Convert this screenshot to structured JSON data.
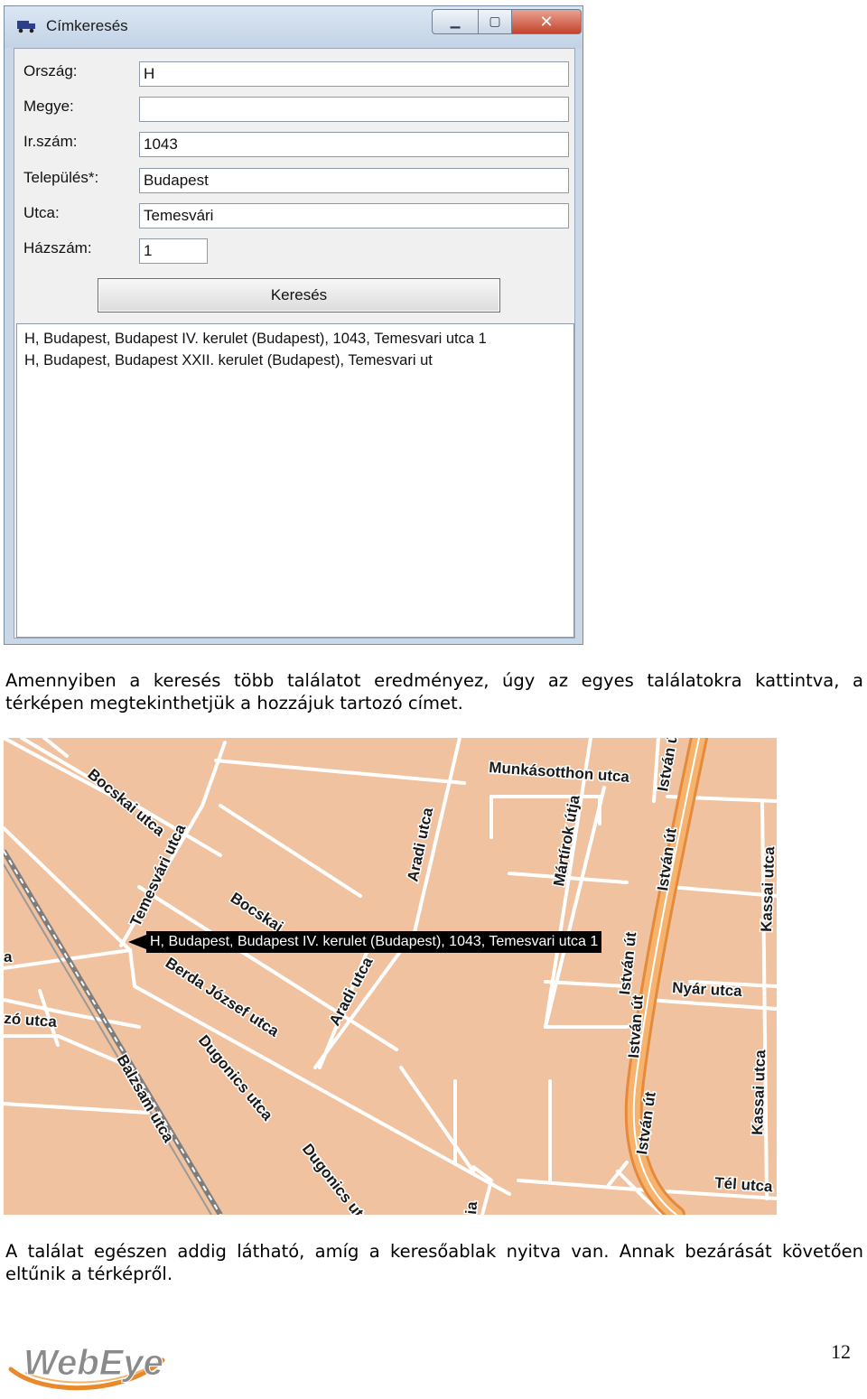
{
  "dialog": {
    "title": "Címkeresés",
    "controls": {
      "minimize": "▁",
      "maximize": "▢",
      "close": "✕"
    },
    "fields": [
      {
        "label": "Ország:",
        "value": "H"
      },
      {
        "label": "Megye:",
        "value": ""
      },
      {
        "label": "Ir.szám:",
        "value": "1043"
      },
      {
        "label": "Település*:",
        "value": "Budapest"
      },
      {
        "label": "Utca:",
        "value": "Temesvári"
      },
      {
        "label": "Házszám:",
        "value": "1"
      }
    ],
    "search_button": "Keresés",
    "results": [
      "H, Budapest, Budapest IV. kerulet (Budapest), 1043, Temesvari utca 1",
      "H, Budapest, Budapest XXII. kerulet (Budapest), Temesvari ut"
    ]
  },
  "paragraph1": "Amennyiben a keresés több találatot eredményez, úgy az egyes találatokra kattintva, a térképen megtekinthetjük a hozzájuk tartozó címet.",
  "map": {
    "tooltip": "H, Budapest, Budapest IV. kerulet (Budapest), 1043, Temesvari utca 1",
    "streets": [
      "Munkásotthon utca",
      "István út",
      "Bocskai utca",
      "Temesvári utca",
      "Aradi utca",
      "Mártírok útja",
      "István út",
      "Kassai utca",
      "Bocskai",
      "István út",
      "Nyár utca",
      "Berda József utca",
      "Aradi utca",
      "zó utca",
      "István út",
      "Dugonics utca",
      "Balzsam utca",
      "István út",
      "Kassai utca",
      "Dugonics ut",
      "Tél utca",
      "a",
      "ia"
    ],
    "colors": {
      "land": "#f0c29f",
      "road": "#ffffff",
      "highway": "#f5a55a",
      "railway": "#777777"
    }
  },
  "paragraph2": "A találat egészen addig látható, amíg a keresőablak nyitva van. Annak bezárását követően eltűnik a térképről.",
  "footer": {
    "logo_text": "WebEye",
    "page_number": "12"
  }
}
